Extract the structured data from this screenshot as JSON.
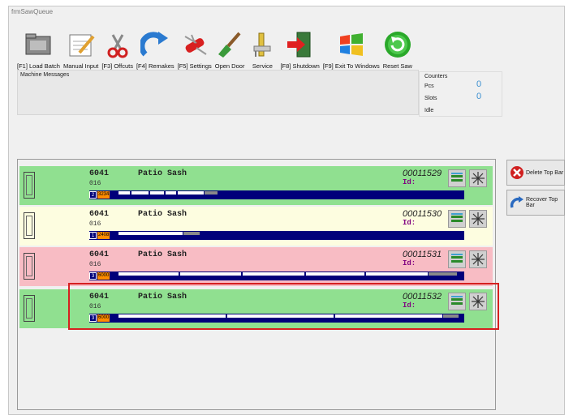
{
  "window": {
    "title": "frmSawQueue"
  },
  "toolbar": [
    {
      "label": "[F1] Load Batch",
      "icon": "folder-icon"
    },
    {
      "label": "Manual Input",
      "icon": "notepad-pencil-icon"
    },
    {
      "label": "[F3] Offcuts",
      "icon": "scissors-icon"
    },
    {
      "label": "[F4] Remakes",
      "icon": "redo-arrow-icon"
    },
    {
      "label": "[F5] Settings",
      "icon": "swiss-knife-icon"
    },
    {
      "label": "Open Door",
      "icon": "paintbrush-icon"
    },
    {
      "label": "Service",
      "icon": "caliper-icon"
    },
    {
      "label": "[F8] Shutdown",
      "icon": "exit-door-icon"
    },
    {
      "label": "[F9] Exit To Windows",
      "icon": "windows-logo-icon"
    },
    {
      "label": "Reset Saw",
      "icon": "reset-icon"
    }
  ],
  "messages": {
    "caption": "Machine Messages"
  },
  "counters": {
    "caption": "Counters",
    "pcs_label": "Pcs",
    "pcs": "0",
    "slots_label": "Slots",
    "slots": "0",
    "idle_label": "Idle"
  },
  "bars": [
    {
      "profile": "6041",
      "desc": "Patio Sash",
      "color": "016",
      "number": "00011529",
      "id_label": "Id:",
      "count": "2",
      "length": "3234",
      "bg": "#90e090",
      "pieces": [
        [
          0,
          14
        ],
        [
          15,
          36
        ],
        [
          37,
          54
        ],
        [
          55,
          68
        ],
        [
          69,
          100
        ]
      ],
      "waste": [
        100,
        115
      ]
    },
    {
      "profile": "6041",
      "desc": "Patio Sash",
      "color": "016",
      "number": "00011530",
      "id_label": "Id:",
      "count": "1",
      "length": "2408",
      "bg": "#fdfde0",
      "pieces": [
        [
          0,
          75
        ]
      ],
      "waste": [
        75,
        94
      ]
    },
    {
      "profile": "6041",
      "desc": "Patio Sash",
      "color": "016",
      "number": "00011531",
      "id_label": "Id:",
      "count": "3",
      "length": "6000",
      "bg": "#f8bcc4",
      "pieces": [
        [
          0,
          71
        ],
        [
          72,
          143
        ],
        [
          144,
          217
        ],
        [
          218,
          287
        ],
        [
          288,
          360
        ]
      ],
      "waste": [
        360,
        393
      ]
    },
    {
      "profile": "6041",
      "desc": "Patio Sash",
      "color": "016",
      "number": "00011532",
      "id_label": "Id:",
      "count": "3",
      "length": "6000",
      "bg": "#90e090",
      "pieces": [
        [
          0,
          125
        ],
        [
          126,
          251
        ],
        [
          252,
          377
        ]
      ],
      "waste": [
        377,
        395
      ]
    }
  ],
  "side_buttons": {
    "delete_label": "Delete Top Bar",
    "recover_label": "Recover Top Bar"
  }
}
